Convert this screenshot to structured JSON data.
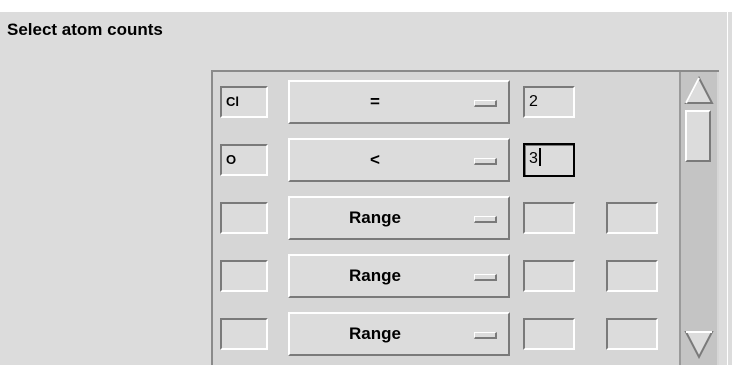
{
  "section": {
    "title": "Select atom counts"
  },
  "rows": [
    {
      "symbol": "Cl",
      "operator": "=",
      "value1": "2",
      "value2": null
    },
    {
      "symbol": "O",
      "operator": "<",
      "value1": "3",
      "value2": null
    },
    {
      "symbol": "",
      "operator": "Range",
      "value1": "",
      "value2": ""
    },
    {
      "symbol": "",
      "operator": "Range",
      "value1": "",
      "value2": ""
    },
    {
      "symbol": "",
      "operator": "Range",
      "value1": "",
      "value2": ""
    }
  ],
  "focused_field": "row-2-value1",
  "scrollbar": {
    "up_icon": "arrow-up-icon",
    "down_icon": "arrow-down-icon"
  }
}
